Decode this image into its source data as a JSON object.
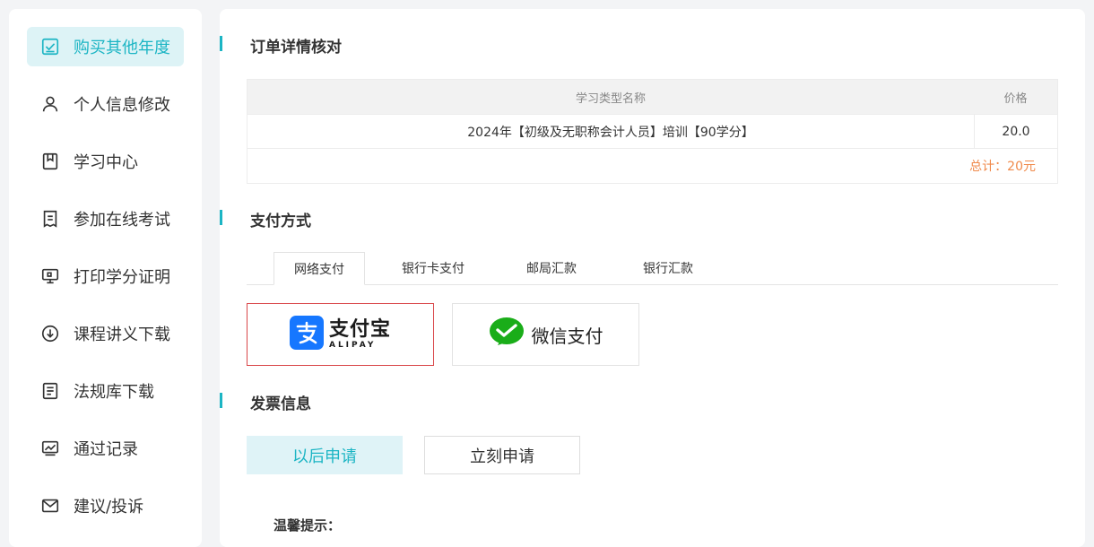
{
  "sidebar": {
    "items": [
      {
        "label": "购买其他年度",
        "icon": "checkbox-icon",
        "active": true
      },
      {
        "label": "个人信息修改",
        "icon": "user-icon",
        "active": false
      },
      {
        "label": "学习中心",
        "icon": "bookmark-icon",
        "active": false
      },
      {
        "label": "参加在线考试",
        "icon": "exam-icon",
        "active": false
      },
      {
        "label": "打印学分证明",
        "icon": "monitor-print-icon",
        "active": false
      },
      {
        "label": "课程讲义下载",
        "icon": "download-icon",
        "active": false
      },
      {
        "label": "法规库下载",
        "icon": "document-icon",
        "active": false
      },
      {
        "label": "通过记录",
        "icon": "chart-icon",
        "active": false
      },
      {
        "label": "建议/投诉",
        "icon": "mail-icon",
        "active": false
      }
    ]
  },
  "order": {
    "title": "订单详情核对",
    "columns": {
      "name": "学习类型名称",
      "price": "价格"
    },
    "rows": [
      {
        "name": "2024年【初级及无职称会计人员】培训【90学分】",
        "price": "20.0"
      }
    ],
    "total": "总计：20元"
  },
  "payment": {
    "title": "支付方式",
    "tabs": [
      "网络支付",
      "银行卡支付",
      "邮局汇款",
      "银行汇款"
    ],
    "active_tab": 0,
    "options": {
      "alipay_cn": "支付宝",
      "alipay_en": "ALIPAY",
      "wechat": "微信支付"
    },
    "colors": {
      "alipay_blue": "#1677ff",
      "wechat_green": "#1aad19",
      "selected_border": "#d9474a"
    }
  },
  "invoice": {
    "title": "发票信息",
    "later_label": "以后申请",
    "now_label": "立刻申请",
    "tip_label": "温馨提示："
  },
  "theme": {
    "accent": "#1cb5c4",
    "total_color": "#f08a4b"
  }
}
